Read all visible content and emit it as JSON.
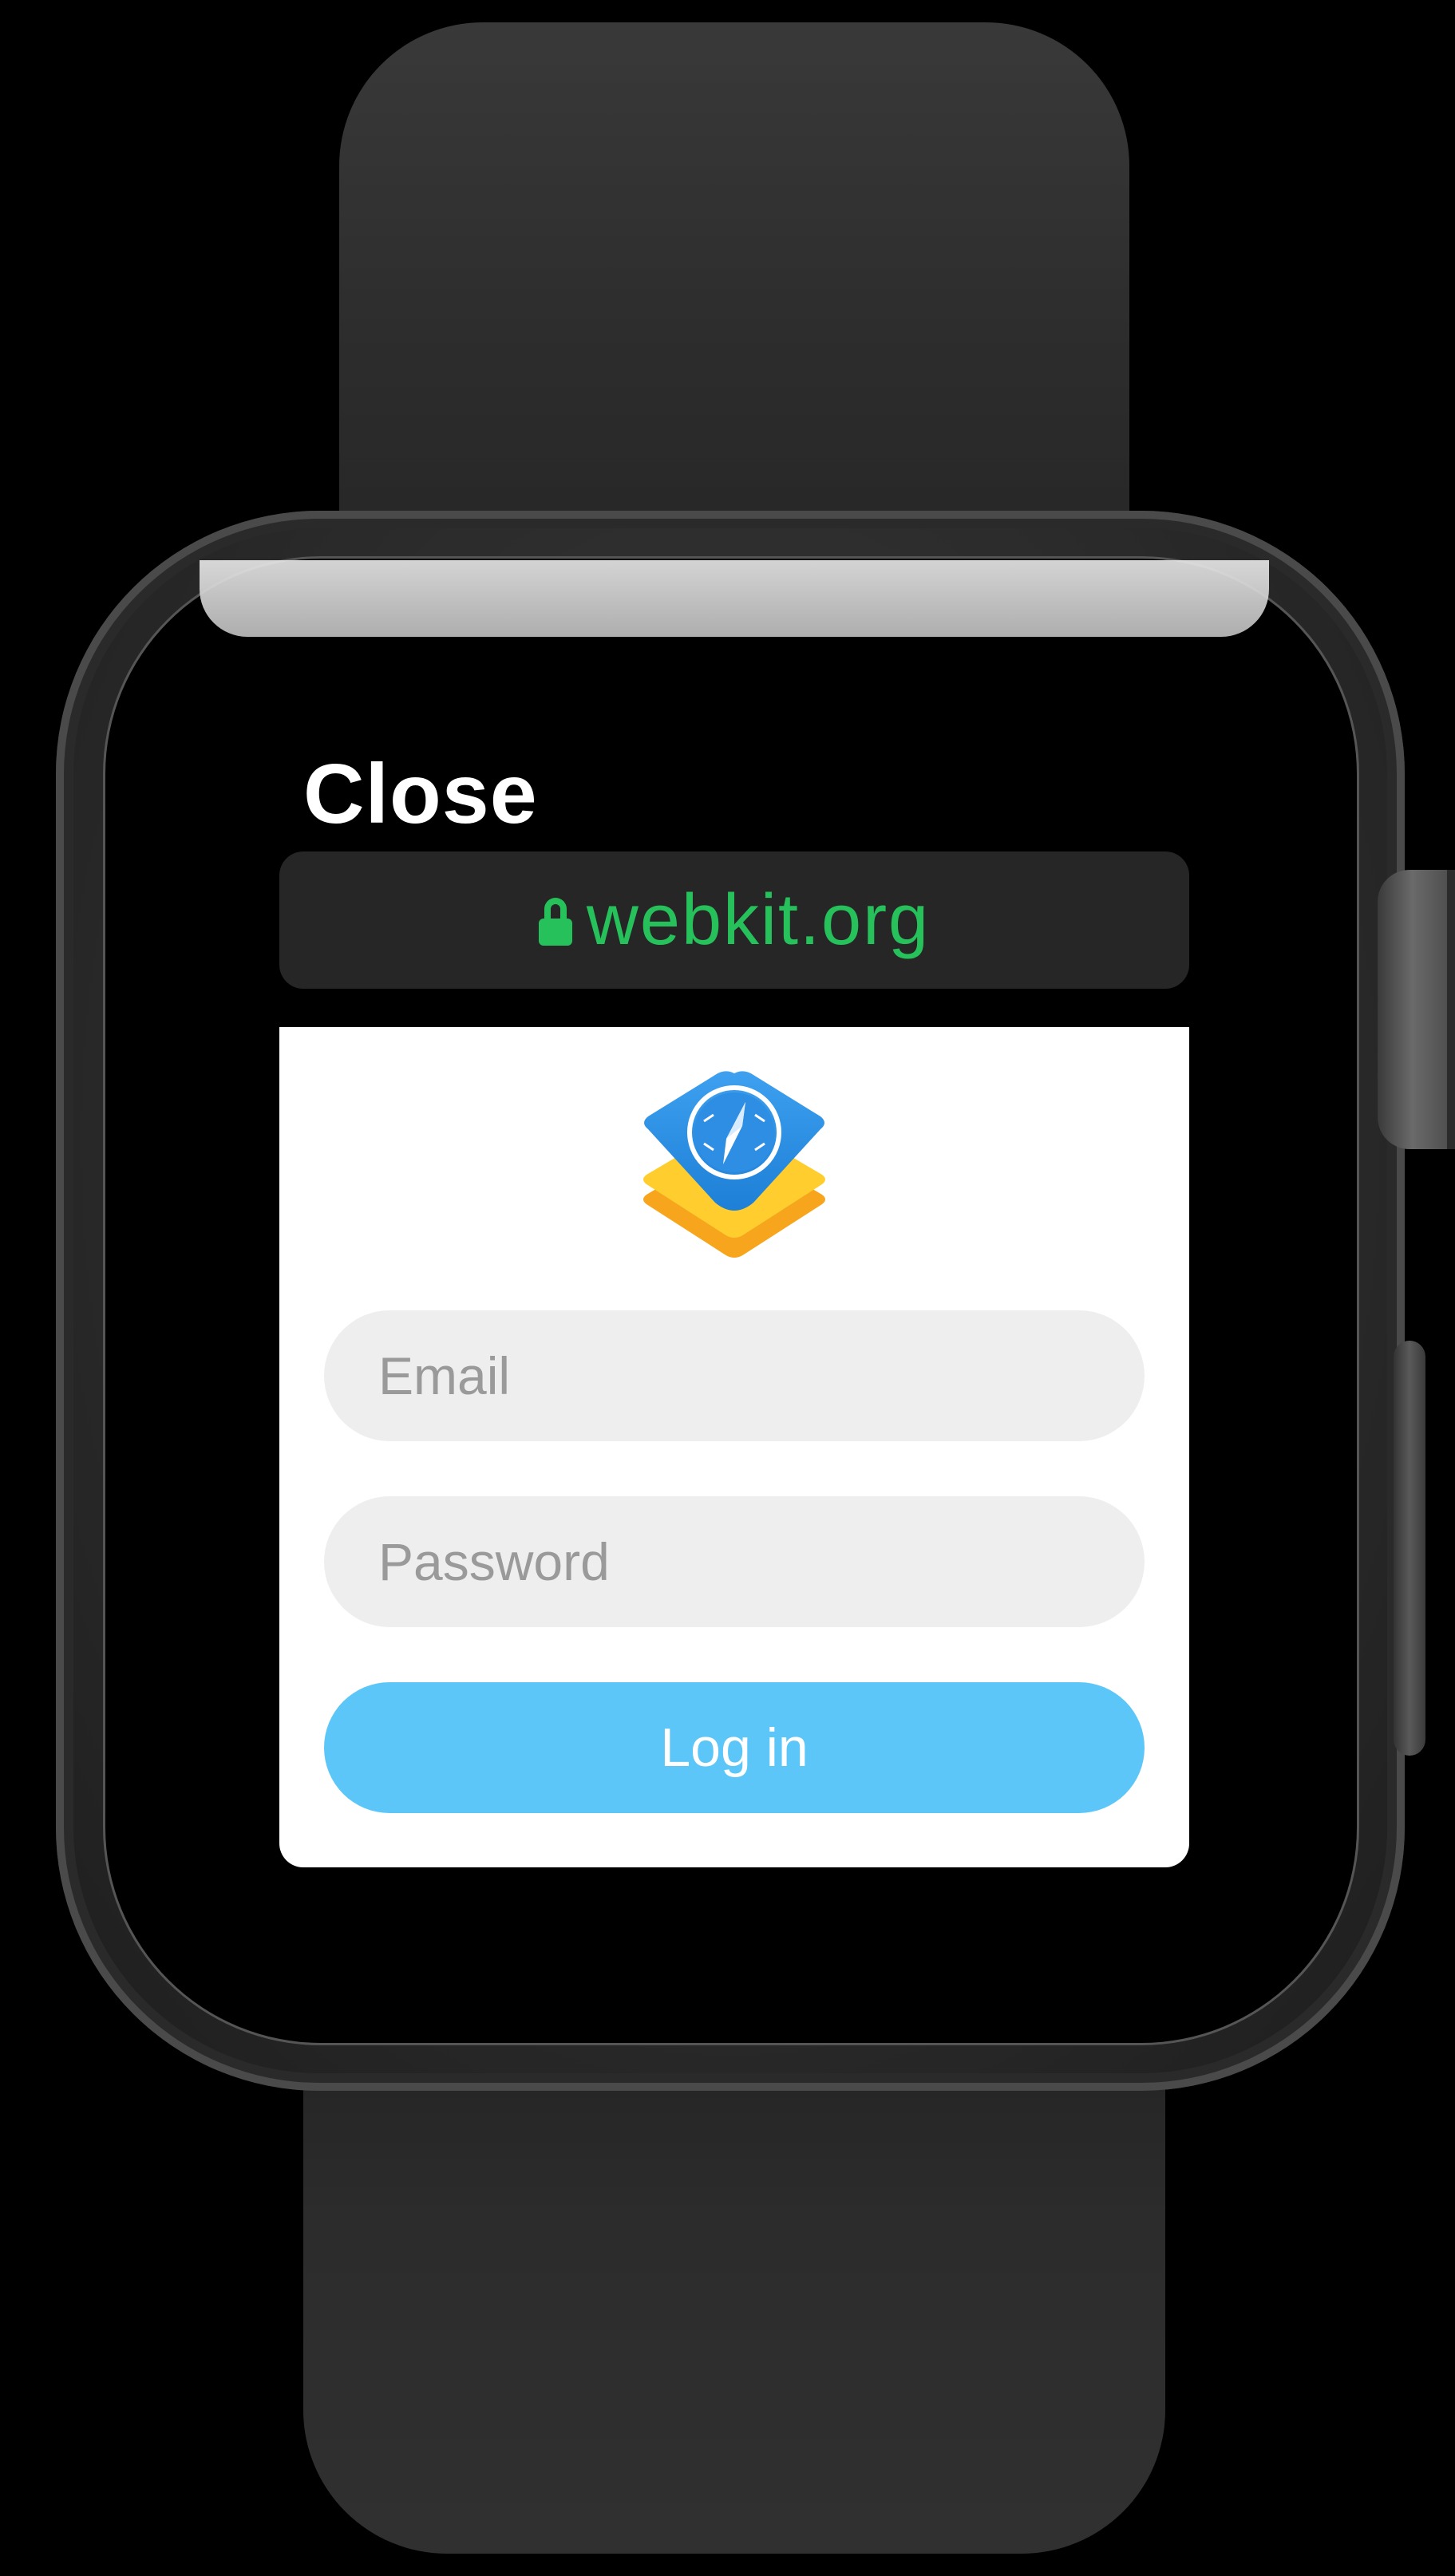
{
  "nav": {
    "close_label": "Close"
  },
  "address_bar": {
    "url": "webkit.org",
    "secure_icon": "lock-icon",
    "url_color": "#26c15b"
  },
  "page": {
    "logo": "webkit-logo",
    "email_placeholder": "Email",
    "password_placeholder": "Password",
    "login_label": "Log in",
    "login_color": "#5bc6f7"
  }
}
